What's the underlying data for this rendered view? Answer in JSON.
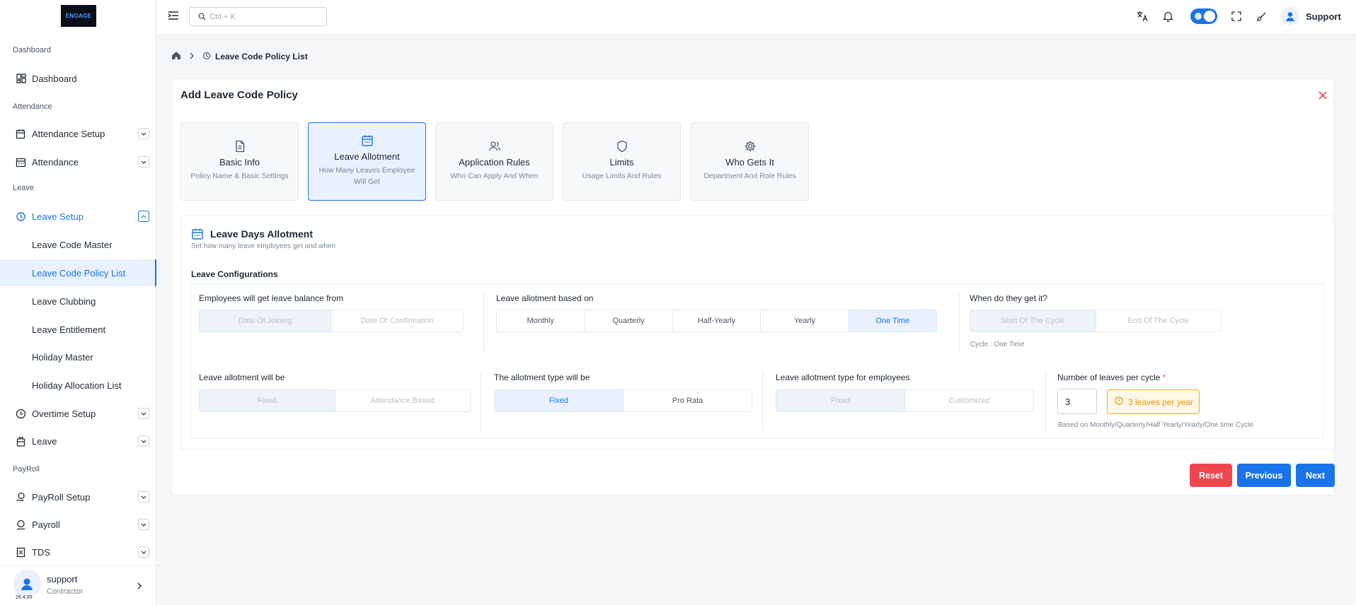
{
  "app": {
    "logo_text": "ENGAGE"
  },
  "sidebar": {
    "sections": [
      "Dashboard",
      "Attendance",
      "Leave",
      "PayRoll"
    ],
    "items": [
      {
        "label": "Dashboard"
      },
      {
        "label": "Attendance Setup"
      },
      {
        "label": "Attendance"
      },
      {
        "label": "Leave Setup"
      },
      {
        "label": "Leave Code Master"
      },
      {
        "label": "Leave Code Policy List"
      },
      {
        "label": "Leave Clubbing"
      },
      {
        "label": "Leave Entitlement"
      },
      {
        "label": "Holiday Master"
      },
      {
        "label": "Holiday Allocation List"
      },
      {
        "label": "Overtime Setup"
      },
      {
        "label": "Leave"
      },
      {
        "label": "PayRoll Setup"
      },
      {
        "label": "Payroll"
      },
      {
        "label": "TDS"
      }
    ],
    "user": {
      "name": "support",
      "role": "Contractor",
      "version": "26.4.20"
    }
  },
  "topbar": {
    "search_placeholder": "Ctrl + K",
    "user_label": "Support"
  },
  "breadcrumb": {
    "current": "Leave Code Policy List"
  },
  "form": {
    "title": "Add Leave Code Policy",
    "steps": [
      {
        "title": "Basic Info",
        "desc": "Policy Name & Basic Settings"
      },
      {
        "title": "Leave Allotment",
        "desc": "How Many Leaves Employee Will Get"
      },
      {
        "title": "Application Rules",
        "desc": "Who Can Apply And When"
      },
      {
        "title": "Limits",
        "desc": "Usage Limits And Rules"
      },
      {
        "title": "Who Gets It",
        "desc": "Department And Role Rules"
      }
    ],
    "section_title": "Leave Days Allotment",
    "section_desc": "Set how many leave employees get and when",
    "config_label": "Leave Configurations",
    "balance_from": {
      "label": "Employees will get leave balance from",
      "options": [
        "Date Of Joining",
        "Date Of Confirmation"
      ]
    },
    "allotment_based": {
      "label": "Leave allotment based on",
      "options": [
        "Monthly",
        "Quarterly",
        "Half-Yearly",
        "Yearly",
        "One Time"
      ],
      "selected": "One Time"
    },
    "when": {
      "label": "When do they get it?",
      "options": [
        "Start Of The Cycle",
        "End Of The Cycle"
      ],
      "note": "Cycle : One Time"
    },
    "allotment_will_be": {
      "label": "Leave allotment will be",
      "options": [
        "Fixed",
        "Attendance Based"
      ]
    },
    "allotment_type": {
      "label": "The allotment type will be",
      "options": [
        "Fixed",
        "Pro Rata"
      ],
      "selected": "Fixed"
    },
    "type_for_employees": {
      "label": "Leave allotment type for employees",
      "options": [
        "Fixed",
        "Customized"
      ]
    },
    "leaves_per_cycle": {
      "label": "Number of leaves per cycle",
      "required_mark": "*",
      "value": "3",
      "badge": "3 leaves per year",
      "note": "Based on Monthly/Quarterly/Half Yearly/Yearly/One time Cycle"
    },
    "buttons": {
      "reset": "Reset",
      "previous": "Previous",
      "next": "Next"
    }
  },
  "colors": {
    "accent": "#1a73e8",
    "danger": "#f0474f",
    "warning": "#f5a623"
  }
}
